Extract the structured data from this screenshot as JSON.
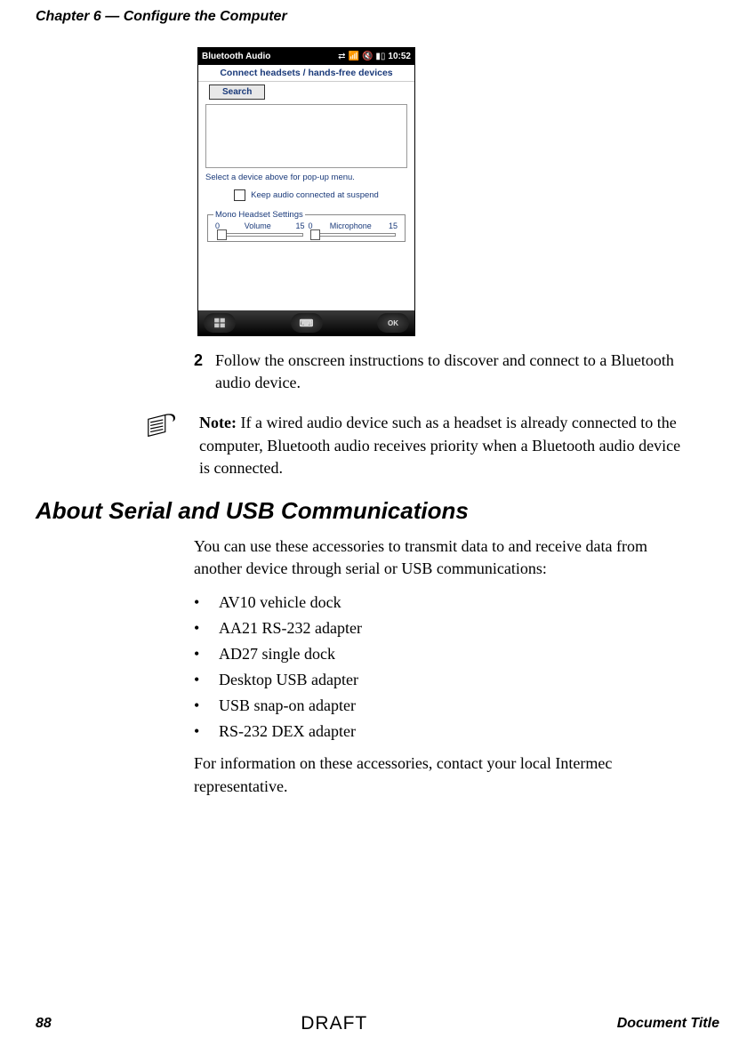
{
  "header": {
    "chapter": "Chapter 6 — Configure the Computer"
  },
  "screenshot": {
    "status_title": "Bluetooth Audio",
    "status_time": "10:52",
    "connect_label": "Connect headsets / hands-free devices",
    "search_label": "Search",
    "select_text": "Select a device above for pop-up menu.",
    "checkbox_label": "Keep audio connected at suspend",
    "mono_legend": "Mono Headset Settings",
    "vol_min": "0",
    "vol_label": "Volume",
    "vol_max": "15",
    "mic_min": "0",
    "mic_label": "Microphone",
    "mic_max": "15",
    "ok_label": "OK"
  },
  "step": {
    "num": "2",
    "text": "Follow the onscreen instructions to discover and connect to a Bluetooth audio device."
  },
  "note": {
    "prefix": "Note:",
    "text": " If a wired audio device such as a headset is already connected to the computer, Bluetooth audio receives priority when a Bluetooth audio device is connected."
  },
  "section": {
    "heading": "About Serial and USB Communications",
    "intro": "You can use these accessories to transmit data to and receive data from another device through serial or USB communications:",
    "bullets": [
      "AV10 vehicle dock",
      "AA21 RS-232 adapter",
      "AD27 single dock",
      "Desktop USB adapter",
      "USB snap-on adapter",
      "RS-232 DEX adapter"
    ],
    "outro": "For information on these accessories, contact your local Intermec representative."
  },
  "footer": {
    "page": "88",
    "watermark": "DRAFT",
    "doc": "Document Title"
  }
}
